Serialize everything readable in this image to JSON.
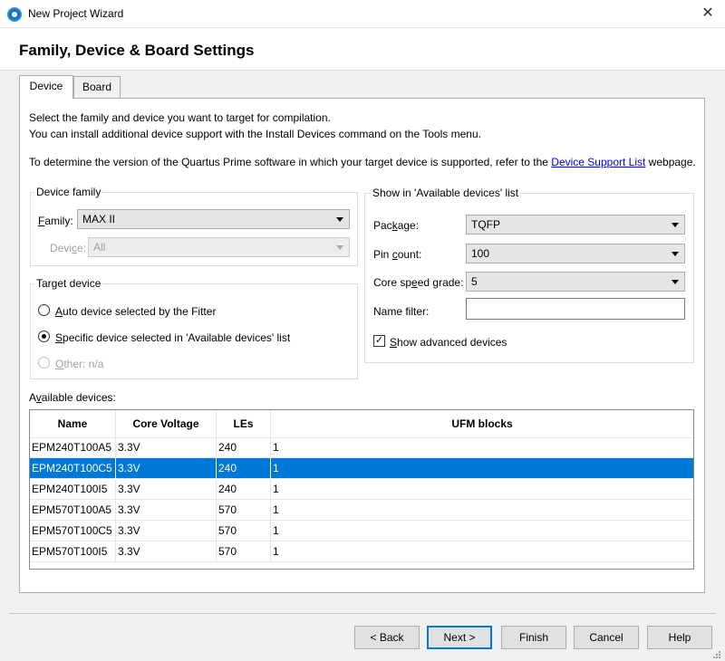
{
  "window": {
    "title": "New Project Wizard",
    "close_glyph": "✕",
    "icon": "quartus-app-icon",
    "accent_color": "#0078d7"
  },
  "page": {
    "title": "Family, Device & Board Settings"
  },
  "tabs": [
    {
      "label": "Device",
      "selected": true
    },
    {
      "label": "Board",
      "selected": false
    }
  ],
  "intro": {
    "line1": "Select the family and device you want to target for compilation.",
    "line2": "You can install additional device support with the Install Devices command on the Tools menu.",
    "line3_prefix": "To determine the version of the Quartus Prime software in which your target device is supported, refer to the ",
    "line3_link": "Device Support List",
    "line3_suffix": " webpage."
  },
  "device_family": {
    "group_label": "Device family",
    "family_label_u": "F",
    "family_label_rest": "amily:",
    "family_value": "MAX II",
    "device_label_pre": "Devi",
    "device_label_u": "c",
    "device_label_post": "e:",
    "device_value": "All"
  },
  "target_device": {
    "group_label": "Target device",
    "auto_u": "A",
    "auto_rest": "uto device selected by the Fitter",
    "specific_u": "S",
    "specific_rest": "pecific device selected in 'Available devices' list",
    "other_u": "O",
    "other_rest": "ther:",
    "other_value": "n/a",
    "selected": "specific"
  },
  "filters": {
    "group_label": "Show in 'Available devices' list",
    "package_label_pre": "Pac",
    "package_label_u": "k",
    "package_label_post": "age:",
    "package_value": "TQFP",
    "pin_label_pre": "Pin ",
    "pin_label_u": "c",
    "pin_label_post": "ount:",
    "pin_value": "100",
    "speed_label_pre": "Core sp",
    "speed_label_u": "e",
    "speed_label_post": "ed grade:",
    "speed_value": "5",
    "name_filter_label": "Name filter:",
    "name_filter_value": "",
    "show_advanced_u": "S",
    "show_advanced_rest": "how advanced devices",
    "show_advanced_checked": true,
    "check_glyph": "✓"
  },
  "devices": {
    "label_pre": "A",
    "label_u": "v",
    "label_post": "ailable devices:",
    "columns": [
      "Name",
      "Core Voltage",
      "LEs",
      "UFM blocks"
    ],
    "rows": [
      [
        "EPM240T100A5",
        "3.3V",
        "240",
        "1"
      ],
      [
        "EPM240T100C5",
        "3.3V",
        "240",
        "1"
      ],
      [
        "EPM240T100I5",
        "3.3V",
        "240",
        "1"
      ],
      [
        "EPM570T100A5",
        "3.3V",
        "570",
        "1"
      ],
      [
        "EPM570T100C5",
        "3.3V",
        "570",
        "1"
      ],
      [
        "EPM570T100I5",
        "3.3V",
        "570",
        "1"
      ]
    ],
    "selected_row": 1
  },
  "footer": {
    "back_label": "< Back",
    "next_label": "Next >",
    "finish_label": "Finish",
    "cancel_label": "Cancel",
    "help_label": "Help"
  }
}
